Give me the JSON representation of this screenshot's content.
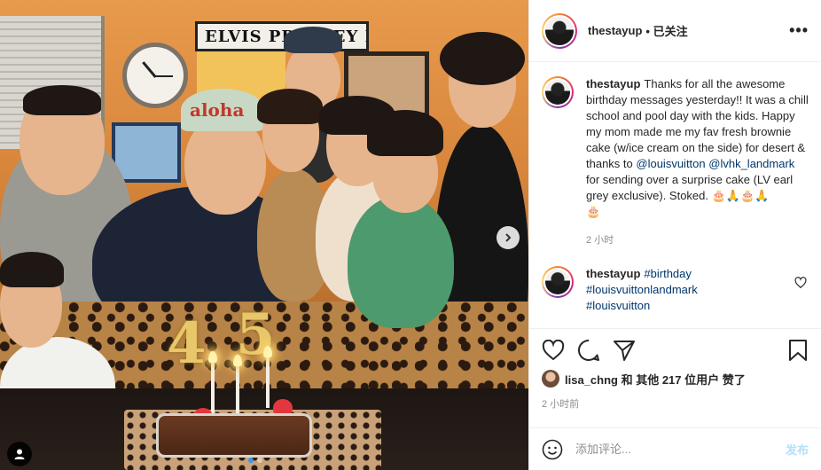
{
  "post": {
    "username": "thestayup",
    "follow_status": "• 已关注",
    "more_icon": "more-horizontal-icon"
  },
  "photo": {
    "sign_text": "ELVIS PRESLEY BLVD",
    "cap_text": "aloha"
  },
  "caption": {
    "username": "thestayup",
    "text_1": "Thanks for all the awesome birthday messages yesterday!! It was a chill school and pool day with the kids. Happy my mom made me my fav fresh brownie cake (w/ice cream on the side) for desert & thanks to",
    "mention_1": "@louisvuitton",
    "mention_2": "@lvhk_landmark",
    "text_2": "for sending over a surprise cake (LV earl grey exclusive). Stoked. 🎂🙏🎂🙏",
    "text_3": "🎂",
    "time": "2 小时"
  },
  "comment": {
    "username": "thestayup",
    "tags": [
      "#birthday",
      "#louisvuittonlandmark",
      "#louisvuitton"
    ]
  },
  "likes": {
    "first_liker": "lisa_chng",
    "text": "和 其他 217 位用户 赞了"
  },
  "post_time": "2 小时前",
  "add_comment": {
    "placeholder": "添加评论...",
    "post_label": "发布"
  },
  "colors": {
    "link": "#00376b",
    "post_button_disabled": "#b2dffc",
    "carousel_active_dot": "#3897f0"
  }
}
